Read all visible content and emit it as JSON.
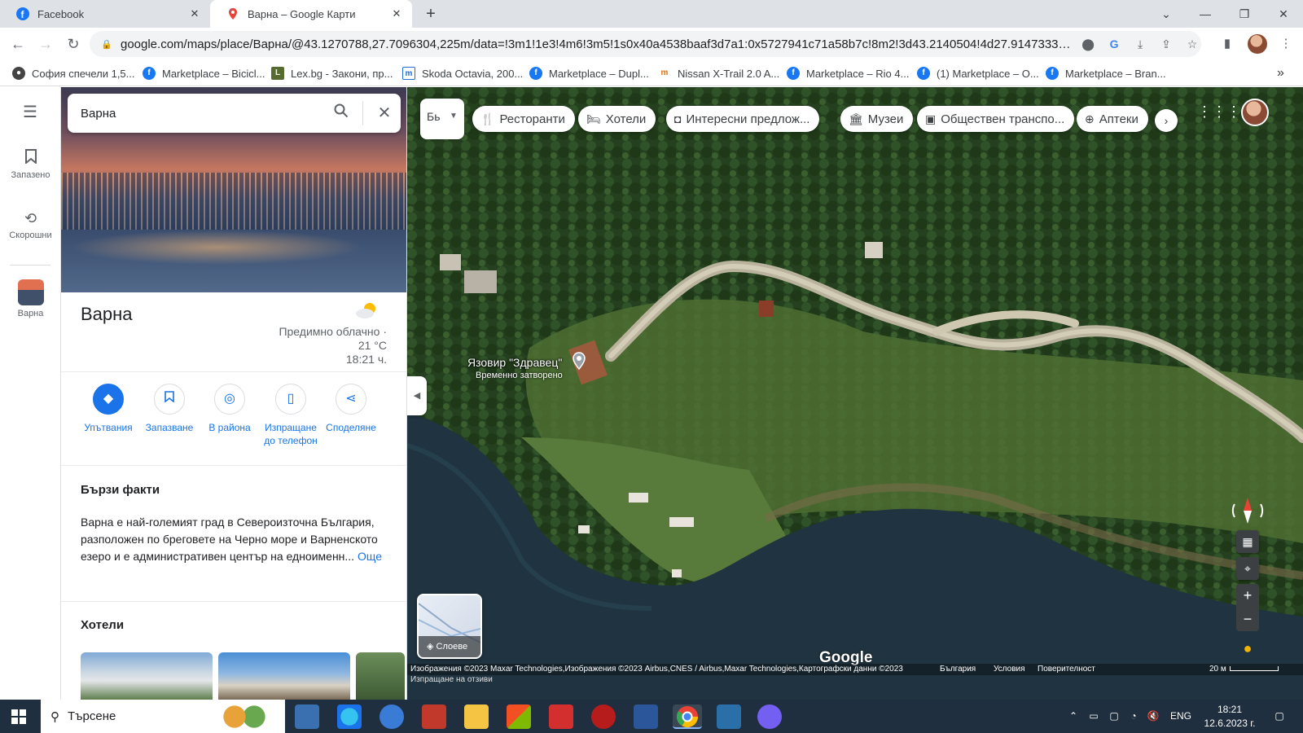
{
  "browser": {
    "tabs": [
      {
        "title": "Facebook",
        "icon": "facebook-icon"
      },
      {
        "title": "Варна – Google Карти",
        "icon": "google-maps-icon"
      }
    ],
    "url": "google.com/maps/place/Варна/@43.1270788,27.7096304,225m/data=!3m1!1e3!4m6!3m5!1s0x40a4538baaf3d7a1:0x5727941c71a58b7c!8m2!3d43.2140504!4d27.9147333!16zL20v...",
    "bookmarks": [
      {
        "label": "София спечели 1,5...",
        "icon": "sofia-icon"
      },
      {
        "label": "Marketplace – Bicicl...",
        "icon": "facebook-icon"
      },
      {
        "label": "Lex.bg - Закони, пр...",
        "icon": "lex-icon"
      },
      {
        "label": "Skoda Octavia, 200...",
        "icon": "mobile-bg-icon"
      },
      {
        "label": "Marketplace – Dupl...",
        "icon": "facebook-icon"
      },
      {
        "label": "Nissan X-Trail 2.0 A...",
        "icon": "mobile-bg-icon"
      },
      {
        "label": "Marketplace – Rio 4...",
        "icon": "facebook-icon"
      },
      {
        "label": "(1) Marketplace – O...",
        "icon": "facebook-icon"
      },
      {
        "label": "Marketplace – Bran...",
        "icon": "facebook-icon"
      }
    ]
  },
  "rail": {
    "saved_label": "Запазено",
    "recent_label": "Скорошни",
    "place_label": "Варна"
  },
  "panel": {
    "search_value": "Варна",
    "title": "Варна",
    "weather": {
      "condition": "Предимно облачно ·",
      "temp": "21 °C",
      "time": "18:21 ч."
    },
    "actions": [
      {
        "label": "Упътвания",
        "icon": "directions-icon"
      },
      {
        "label": "Запазване",
        "icon": "bookmark-icon"
      },
      {
        "label": "В района",
        "icon": "nearby-icon"
      },
      {
        "label": "Изпращане до телефон",
        "icon": "send-to-phone-icon"
      },
      {
        "label": "Споделяне",
        "icon": "share-icon"
      }
    ],
    "quick_facts_title": "Бързи факти",
    "quick_facts_text": "Варна е най-големият град в Североизточна България, разположен по бреговете на Черно море и Варненското езеро и е административен център на едноименн...",
    "more_label": "Още",
    "hotels_title": "Хотели"
  },
  "map": {
    "chips": [
      {
        "label": "Ресторанти",
        "icon": "restaurant-icon"
      },
      {
        "label": "Хотели",
        "icon": "hotel-icon"
      },
      {
        "label": "Интересни предлож...",
        "icon": "camera-icon"
      },
      {
        "label": "Музеи",
        "icon": "museum-icon"
      },
      {
        "label": "Обществен транспо...",
        "icon": "transit-icon"
      },
      {
        "label": "Аптеки",
        "icon": "pharmacy-icon"
      }
    ],
    "place_label": "Язовир \"Здравец\"",
    "place_sublabel": "Временно затворено",
    "layers_label": "Слоеве",
    "logo": "Google",
    "attribution": "Изображения ©2023 Maxar Technologies,Изображения ©2023 Airbus,CNES / Airbus,Maxar Technologies,Картографски данни ©2023",
    "country": "България",
    "terms": "Условия",
    "privacy": "Поверителност",
    "feedback": "Изпращане на отзиви",
    "scale": "20 м"
  },
  "taskbar": {
    "search_placeholder": "Търсене",
    "lang": "ENG",
    "time": "18:21",
    "date": "12.6.2023 г."
  }
}
